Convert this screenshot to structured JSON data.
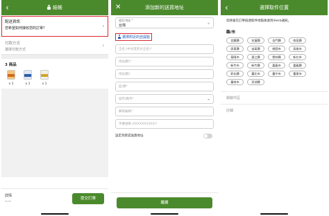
{
  "checkout": {
    "title": "結帳",
    "shipping_label": "配送資訊",
    "shipping_question": "您希望如何接收您的訂單？",
    "payment_label": "付款方式",
    "payment_hint": "選擇付款方式",
    "products_title": "3 商品",
    "products": [
      {
        "qty": "x 1"
      },
      {
        "qty": "x 1"
      },
      {
        "qty": "x 1"
      }
    ],
    "details_label": "詳情",
    "details_value": "--.--",
    "submit_label": "提交訂單"
  },
  "address_form": {
    "title": "添加新的送貨地址",
    "country_label": "國家/地區 *",
    "country_value": "台灣",
    "pick_nearby_label": "選擇附近的自提點",
    "fields": [
      "全名 (中文或英文全名)*",
      "地址欄1*",
      "地址欄2",
      "區/鄉*",
      "城市/縣市*",
      "郵政編碼*",
      "手機號碼 (09XXXXXXXX)*"
    ],
    "default_label": "設定為默認送貨地址",
    "default_on": false,
    "continue_label": "繼續"
  },
  "pickup": {
    "title": "選擇取件位置",
    "note": "您將會在訂單抵達取件地點後收到iHerb通知。",
    "county_heading": "縣/市",
    "cities": [
      "宜蘭縣",
      "花蓮縣",
      "金門縣",
      "南投縣",
      "屏東縣",
      "苗栗縣",
      "桃園市",
      "高雄市",
      "基隆市",
      "連江縣",
      "雲林縣",
      "新北市",
      "新竹市",
      "新竹縣",
      "嘉義市",
      "嘉義縣",
      "彰化縣",
      "臺北市",
      "臺中市",
      "臺東市",
      "臺南市",
      "澎湖縣"
    ],
    "district_label": "鄉鎮市區",
    "store_label": "店鋪"
  },
  "colors": {
    "brand_green": "#4b8a2c",
    "highlight_red": "#d9262c",
    "link_blue": "#1c58b5"
  }
}
